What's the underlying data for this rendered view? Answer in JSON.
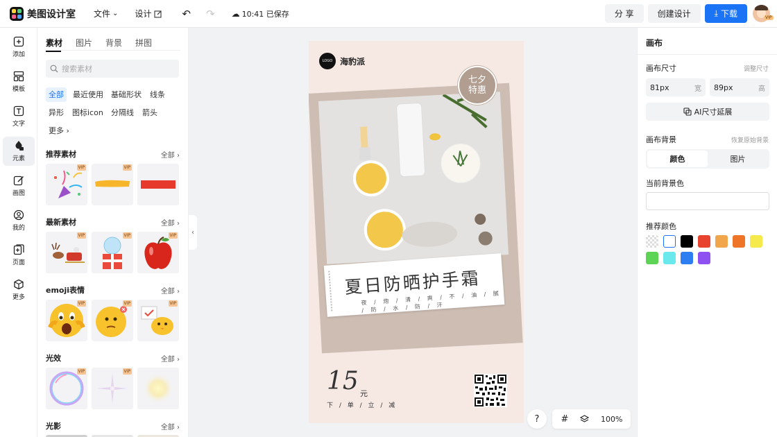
{
  "app": {
    "logo_text": "美图设计室"
  },
  "menu": {
    "file": "文件",
    "design": "设计",
    "saved_status": "10:41 已保存"
  },
  "top_actions": {
    "share": "分 享",
    "create": "创建设计",
    "download": "下载",
    "avatar_badge": "VIP"
  },
  "rail": [
    {
      "label": "添加",
      "icon": "plus-square-icon"
    },
    {
      "label": "模板",
      "icon": "template-icon"
    },
    {
      "label": "文字",
      "icon": "text-icon"
    },
    {
      "label": "元素",
      "icon": "shapes-icon",
      "active": true
    },
    {
      "label": "画图",
      "icon": "edit-icon"
    },
    {
      "label": "我的",
      "icon": "user-icon"
    },
    {
      "label": "页面",
      "icon": "page-icon"
    },
    {
      "label": "更多",
      "icon": "box-icon"
    }
  ],
  "panel": {
    "tabs": [
      "素材",
      "图片",
      "背景",
      "拼图"
    ],
    "search_placeholder": "搜索素材",
    "chips": [
      "全部",
      "最近使用",
      "基础形状",
      "线条",
      "异形",
      "图标icon",
      "分隔线",
      "箭头",
      "更多"
    ],
    "all_label": "全部",
    "vip_label": "VIP",
    "sections": [
      {
        "title": "推荐素材",
        "items": [
          "confetti-party-popper",
          "yellow-brush-stroke",
          "red-bar"
        ]
      },
      {
        "title": "最新素材",
        "items": [
          "reindeer-sleigh",
          "snow-globe-gift",
          "red-apple"
        ]
      },
      {
        "title": "emoji表情",
        "items": [
          "shocked-emoji",
          "thinking-emoji",
          "chick-sign-emoji"
        ]
      },
      {
        "title": "光效",
        "items": [
          "bubble-light",
          "star-sparkle",
          "glow-orb"
        ]
      },
      {
        "title": "光影",
        "items": []
      }
    ]
  },
  "poster": {
    "logo_mark": "LOGO",
    "brand": "海豹派",
    "stamp_line1": "七夕",
    "stamp_line2": "特惠",
    "title": "夏日防晒护手霜",
    "subtitle": "夜 / 炮 / 清 / 爽 / 不 / 油 / 腻 / 防 / 水 / 防 / 汗",
    "price": "15",
    "price_unit": "元",
    "price_note": "下 / 单 / 立 / 减"
  },
  "canvas_tools": {
    "help": "?",
    "zoom": "100%"
  },
  "right_panel": {
    "title": "画布",
    "size_label": "画布尺寸",
    "adjust_size": "调整尺寸",
    "width_value": "81px",
    "width_unit": "宽",
    "height_value": "89px",
    "height_unit": "高",
    "ai_resize": "AI尺寸延展",
    "bg_label": "画布背景",
    "restore_bg": "恢复原始背景",
    "seg_color": "颜色",
    "seg_image": "图片",
    "current_bg": "当前背景色",
    "recommended": "推荐颜色",
    "swatches": [
      "transparent",
      "#ffffff",
      "#000000",
      "#e8432f",
      "#f2a64b",
      "#ee7527",
      "#f6e94b",
      "#5ed457",
      "#6ae9ec",
      "#2d7ef0",
      "#8e50f0"
    ]
  }
}
